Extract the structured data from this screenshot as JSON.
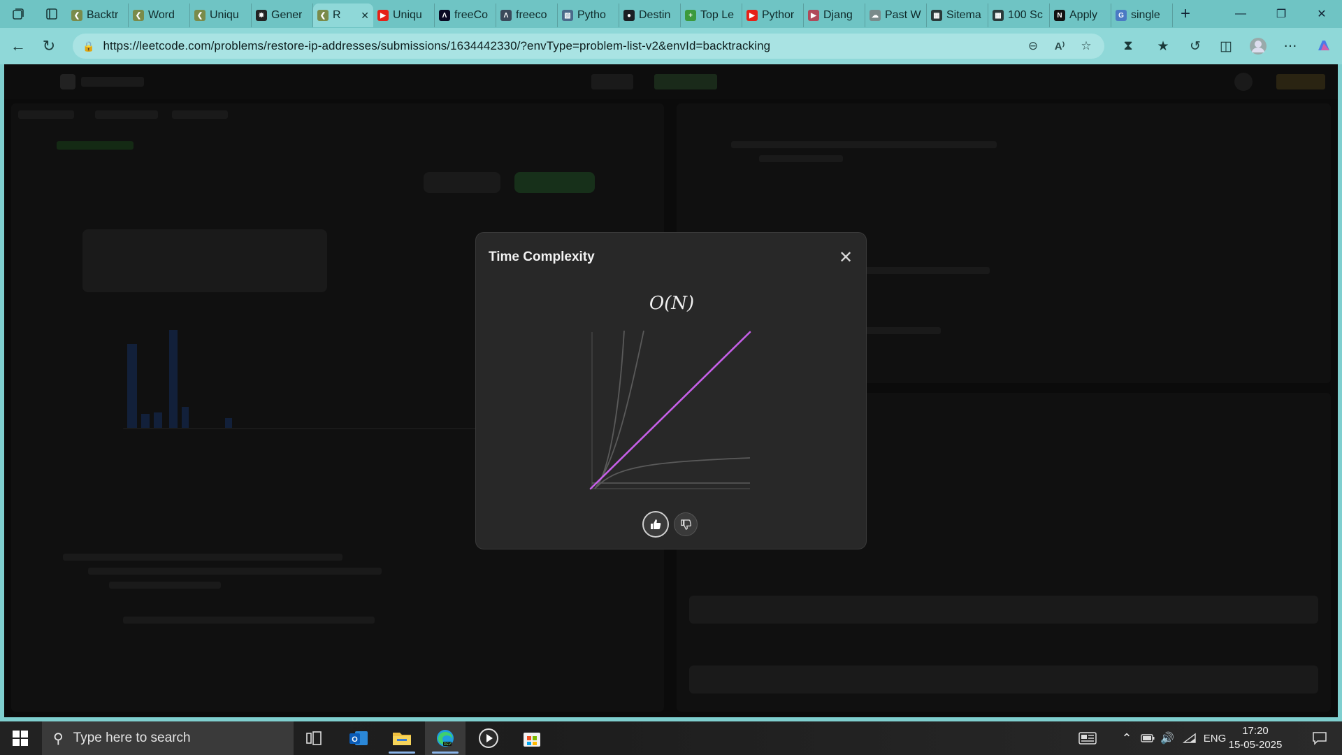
{
  "browser": {
    "tabs": [
      {
        "label": "Backtr",
        "icon": "leetcode-icon",
        "color": "#7a8b4a"
      },
      {
        "label": "Word",
        "icon": "leetcode-icon",
        "color": "#7a8b4a"
      },
      {
        "label": "Uniqu",
        "icon": "leetcode-icon",
        "color": "#7a8b4a"
      },
      {
        "label": "Gener",
        "icon": "chatgpt-icon",
        "color": "#222222"
      },
      {
        "label": "R",
        "icon": "leetcode-icon",
        "color": "#7a8b4a",
        "active": true
      },
      {
        "label": "Uniqu",
        "icon": "youtube-icon",
        "color": "#e62117"
      },
      {
        "label": "freeCo",
        "icon": "freecodecamp-icon",
        "color": "#0a0a23"
      },
      {
        "label": "freeco",
        "icon": "freecodecamp-icon",
        "color": "#3b4a5a"
      },
      {
        "label": "Pytho",
        "icon": "image-icon",
        "color": "#4a6a8a"
      },
      {
        "label": "Destin",
        "icon": "github-icon",
        "color": "#1b1f23"
      },
      {
        "label": "Top Le",
        "icon": "plus-green-icon",
        "color": "#3c9a3c"
      },
      {
        "label": "Pythor",
        "icon": "youtube-icon",
        "color": "#e62117"
      },
      {
        "label": "Djang",
        "icon": "youtube-icon",
        "color": "#b04a5a"
      },
      {
        "label": "Past W",
        "icon": "cloud-icon",
        "color": "#7a8a8a"
      },
      {
        "label": "Sitema",
        "icon": "table-icon",
        "color": "#2a3a3a"
      },
      {
        "label": "100 Sc",
        "icon": "table-icon",
        "color": "#2a3a3a"
      },
      {
        "label": "Apply",
        "icon": "notion-icon",
        "color": "#111111"
      },
      {
        "label": "single",
        "icon": "google-icon",
        "color": "#4a7ac4"
      }
    ],
    "url": "https://leetcode.com/problems/restore-ip-addresses/submissions/1634442330/?envType=problem-list-v2&envId=backtracking"
  },
  "modal": {
    "title": "Time Complexity",
    "complexity": "O(N)",
    "highlight_color": "#c65fe8",
    "curve_color": "#5a5a5a"
  },
  "taskbar": {
    "search_placeholder": "Type here to search",
    "language": "ENG",
    "time": "17:20",
    "date": "15-05-2025"
  }
}
